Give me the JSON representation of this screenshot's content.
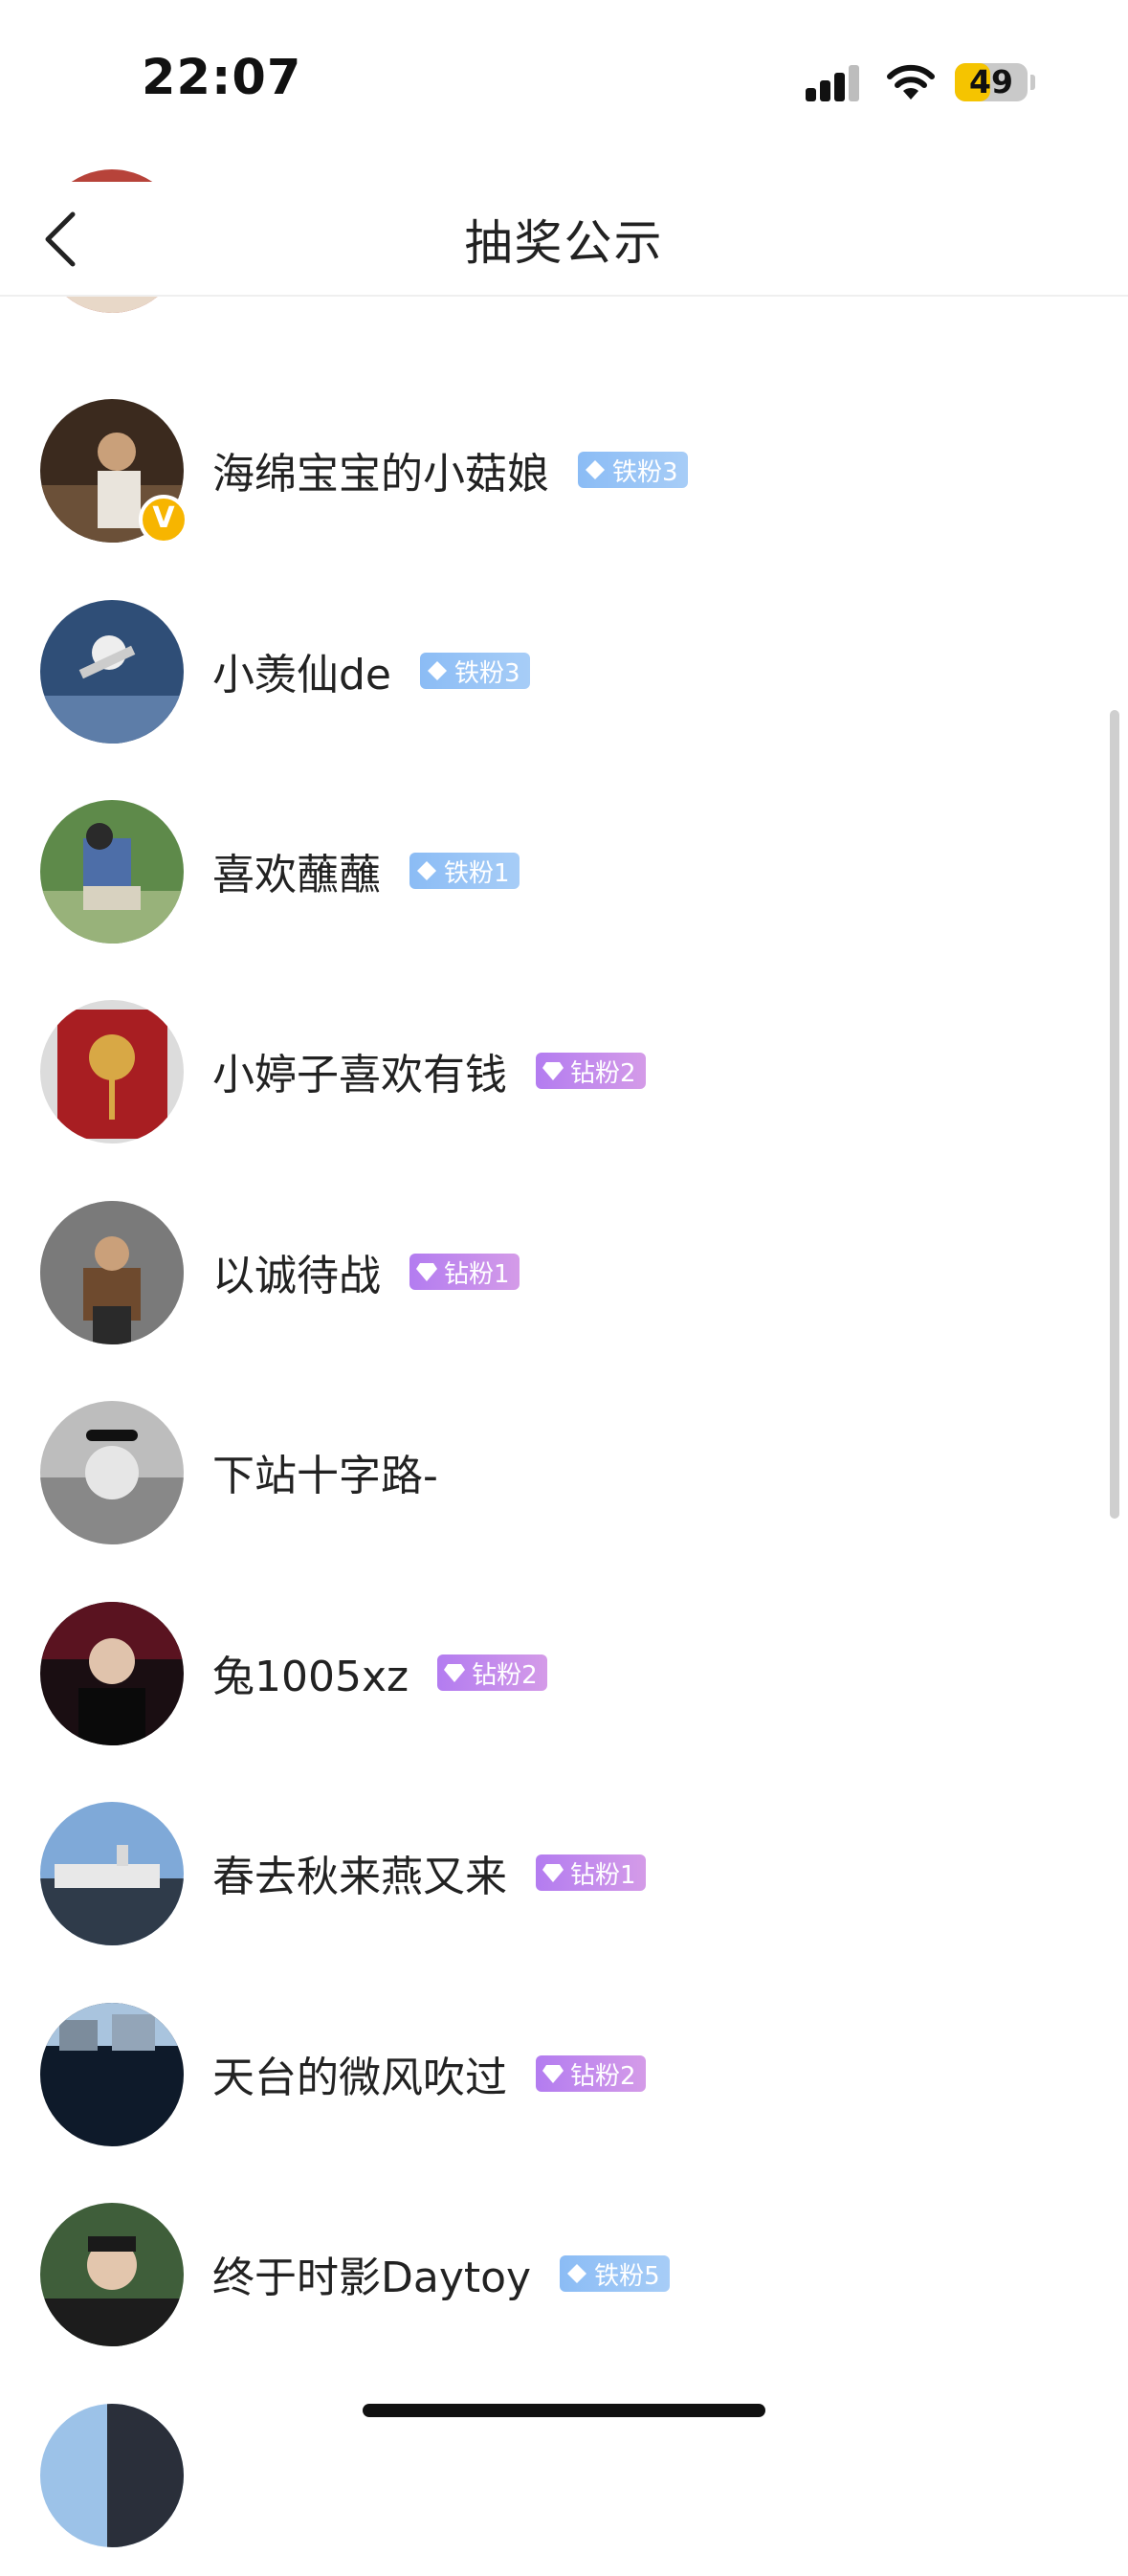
{
  "status": {
    "time": "22:07",
    "battery": "49",
    "battery_level": 0.49
  },
  "nav": {
    "title": "抽奖公示"
  },
  "winners": [
    {
      "name": "",
      "badge": ""
    },
    {
      "name": "海绵宝宝的小菇娘",
      "badge": "铁粉3",
      "badge_type": "iron",
      "verified": true
    },
    {
      "name": "小羡仙de",
      "badge": "铁粉3",
      "badge_type": "iron"
    },
    {
      "name": "喜欢蘸蘸",
      "badge": "铁粉1",
      "badge_type": "iron"
    },
    {
      "name": "小婷子喜欢有钱",
      "badge": "钻粉2",
      "badge_type": "diamond"
    },
    {
      "name": "以诚待战",
      "badge": "钻粉1",
      "badge_type": "diamond"
    },
    {
      "name": "下站十字路-",
      "badge": ""
    },
    {
      "name": "兔1005xz",
      "badge": "钻粉2",
      "badge_type": "diamond"
    },
    {
      "name": "春去秋来燕又来",
      "badge": "钻粉1",
      "badge_type": "diamond"
    },
    {
      "name": "天台的微风吹过",
      "badge": "钻粉2",
      "badge_type": "diamond"
    },
    {
      "name": "终于时影Daytoy",
      "badge": "铁粉5",
      "badge_type": "iron"
    }
  ],
  "colors": {
    "iron_badge": "#8bbcf5",
    "diamond_badge": "#b37cf0",
    "verified": "#f7b500"
  }
}
